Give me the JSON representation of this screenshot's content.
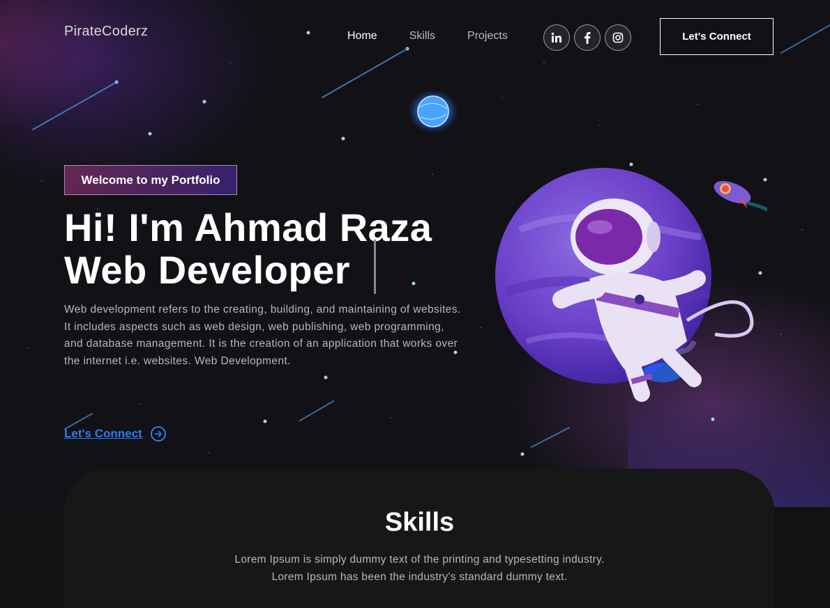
{
  "brand": {
    "logo_text": "PirateCoderz"
  },
  "nav": {
    "items": [
      {
        "label": "Home",
        "active": true
      },
      {
        "label": "Skills",
        "active": false
      },
      {
        "label": "Projects",
        "active": false
      }
    ],
    "social": [
      "linkedin-icon",
      "facebook-icon",
      "instagram-icon"
    ],
    "connect_button": "Let's Connect"
  },
  "banner": {
    "tagline": "Welcome to my Portfolio",
    "headline_line1": "Hi! I'm Ahmad Raza",
    "headline_line2": "Web Developer",
    "description": "Web development refers to the creating, building, and maintaining of websites. It includes aspects such as web design, web publishing, web programming, and database management. It is the creation of an application that works over the internet i.e. websites. Web Development.",
    "cta_label": "Let's Connect "
  },
  "skills": {
    "title": "Skills",
    "text_line1": "Lorem Ipsum is simply dummy text of the printing and typesetting industry.",
    "text_line2": "Lorem Ipsum has been the industry's standard dummy text."
  },
  "colors": {
    "accent_blue": "#2f7cf6",
    "tag_gradient_start": "#aa367c",
    "tag_gradient_end": "#4a2fbd",
    "background": "#121212"
  }
}
